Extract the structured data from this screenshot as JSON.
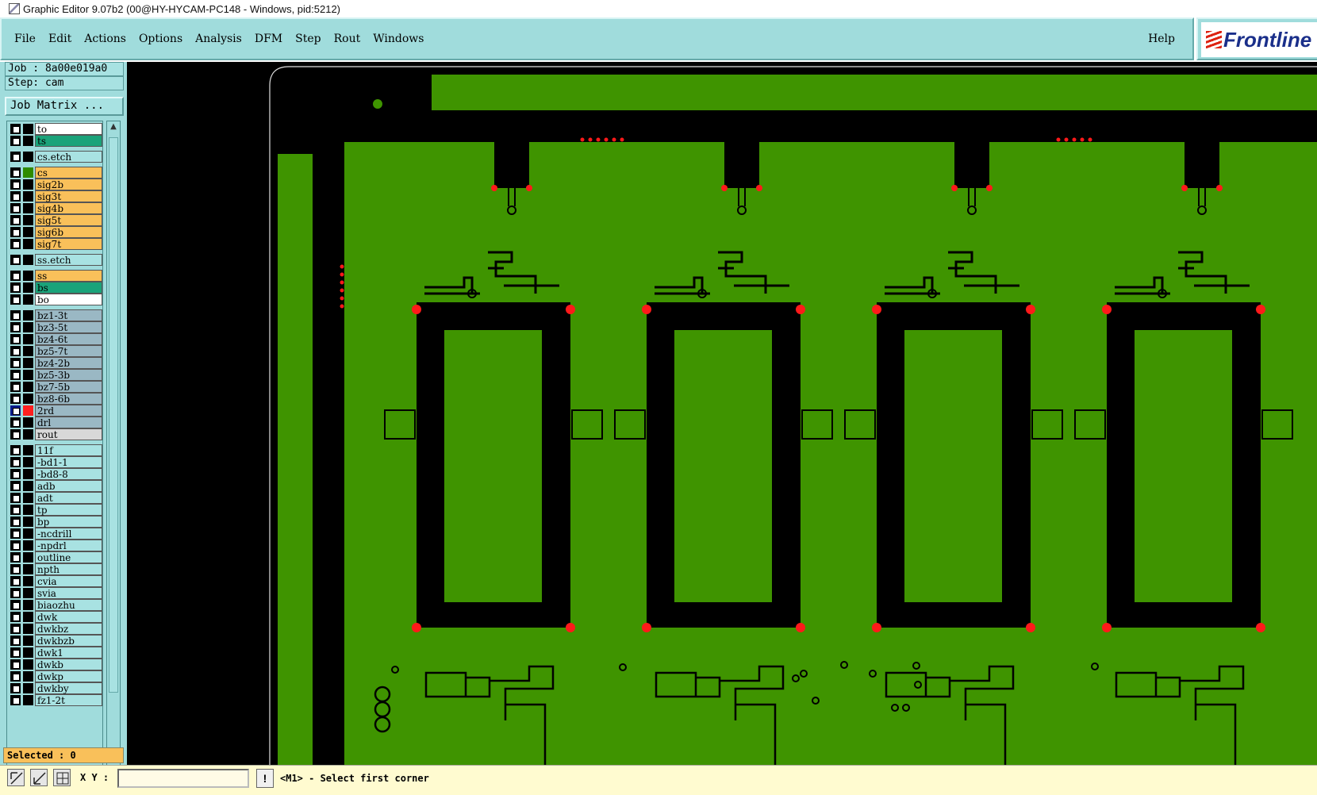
{
  "window": {
    "title": "Graphic Editor 9.07b2 (00@HY-HYCAM-PC148 - Windows, pid:5212)"
  },
  "menubar": {
    "items": [
      "File",
      "Edit",
      "Actions",
      "Options",
      "Analysis",
      "DFM",
      "Step",
      "Rout",
      "Windows"
    ],
    "help": "Help",
    "logo_text": "Frontline"
  },
  "job": {
    "job_label": "Job : 8a00e019a0",
    "step_label": "Step: cam",
    "matrix_button": "Job Matrix ..."
  },
  "layers": [
    {
      "name": "to",
      "color": "#ffffff",
      "swatch": "#000000",
      "group": 0
    },
    {
      "name": "ts",
      "color": "#1aa37a",
      "swatch": "#000000",
      "group": 0
    },
    {
      "name": "cs.etch",
      "color": "#a8e2e2",
      "swatch": "#000000",
      "group": 1
    },
    {
      "name": "cs",
      "color": "#f9c05a",
      "swatch": "#2e8b00",
      "group": 2
    },
    {
      "name": "sig2b",
      "color": "#f9c05a",
      "swatch": "#000000",
      "group": 2
    },
    {
      "name": "sig3t",
      "color": "#f9c05a",
      "swatch": "#000000",
      "group": 2
    },
    {
      "name": "sig4b",
      "color": "#f9c05a",
      "swatch": "#000000",
      "group": 2
    },
    {
      "name": "sig5t",
      "color": "#f9c05a",
      "swatch": "#000000",
      "group": 2
    },
    {
      "name": "sig6b",
      "color": "#f9c05a",
      "swatch": "#000000",
      "group": 2
    },
    {
      "name": "sig7t",
      "color": "#f9c05a",
      "swatch": "#000000",
      "group": 2
    },
    {
      "name": "ss.etch",
      "color": "#a8e2e2",
      "swatch": "#000000",
      "group": 3
    },
    {
      "name": "ss",
      "color": "#f9c05a",
      "swatch": "#000000",
      "group": 4
    },
    {
      "name": "bs",
      "color": "#1aa37a",
      "swatch": "#000000",
      "group": 4
    },
    {
      "name": "bo",
      "color": "#ffffff",
      "swatch": "#000000",
      "group": 4
    },
    {
      "name": "bz1-3t",
      "color": "#9ab8c4",
      "swatch": "#000000",
      "group": 5
    },
    {
      "name": "bz3-5t",
      "color": "#9ab8c4",
      "swatch": "#000000",
      "group": 5
    },
    {
      "name": "bz4-6t",
      "color": "#9ab8c4",
      "swatch": "#000000",
      "group": 5
    },
    {
      "name": "bz5-7t",
      "color": "#9ab8c4",
      "swatch": "#000000",
      "group": 5
    },
    {
      "name": "bz4-2b",
      "color": "#9ab8c4",
      "swatch": "#000000",
      "group": 5
    },
    {
      "name": "bz5-3b",
      "color": "#9ab8c4",
      "swatch": "#000000",
      "group": 5
    },
    {
      "name": "bz7-5b",
      "color": "#9ab8c4",
      "swatch": "#000000",
      "group": 5
    },
    {
      "name": "bz8-6b",
      "color": "#9ab8c4",
      "swatch": "#000000",
      "group": 5
    },
    {
      "name": "2rd",
      "color": "#9ab8c4",
      "swatch": "#ff2020",
      "group": 5,
      "active": true
    },
    {
      "name": "drl",
      "color": "#9ab8c4",
      "swatch": "#000000",
      "group": 5
    },
    {
      "name": "rout",
      "color": "#d8d8d8",
      "swatch": "#000000",
      "group": 5
    },
    {
      "name": "11f",
      "color": "#a8e2e2",
      "swatch": "#000000",
      "group": 6
    },
    {
      "name": "-bd1-1",
      "color": "#a8e2e2",
      "swatch": "#000000",
      "group": 6
    },
    {
      "name": "-bd8-8",
      "color": "#a8e2e2",
      "swatch": "#000000",
      "group": 6
    },
    {
      "name": "adb",
      "color": "#a8e2e2",
      "swatch": "#000000",
      "group": 6
    },
    {
      "name": "adt",
      "color": "#a8e2e2",
      "swatch": "#000000",
      "group": 6
    },
    {
      "name": "tp",
      "color": "#a8e2e2",
      "swatch": "#000000",
      "group": 6
    },
    {
      "name": "bp",
      "color": "#a8e2e2",
      "swatch": "#000000",
      "group": 6
    },
    {
      "name": "-ncdrill",
      "color": "#a8e2e2",
      "swatch": "#000000",
      "group": 6
    },
    {
      "name": "-npdrl",
      "color": "#a8e2e2",
      "swatch": "#000000",
      "group": 6
    },
    {
      "name": "outline",
      "color": "#a8e2e2",
      "swatch": "#000000",
      "group": 6
    },
    {
      "name": "npth",
      "color": "#a8e2e2",
      "swatch": "#000000",
      "group": 6
    },
    {
      "name": "cvia",
      "color": "#a8e2e2",
      "swatch": "#000000",
      "group": 6
    },
    {
      "name": "svia",
      "color": "#a8e2e2",
      "swatch": "#000000",
      "group": 6
    },
    {
      "name": "biaozhu",
      "color": "#a8e2e2",
      "swatch": "#000000",
      "group": 6
    },
    {
      "name": "dwk",
      "color": "#a8e2e2",
      "swatch": "#000000",
      "group": 6
    },
    {
      "name": "dwkbz",
      "color": "#a8e2e2",
      "swatch": "#000000",
      "group": 6
    },
    {
      "name": "dwkbzb",
      "color": "#a8e2e2",
      "swatch": "#000000",
      "group": 6
    },
    {
      "name": "dwk1",
      "color": "#a8e2e2",
      "swatch": "#000000",
      "group": 6
    },
    {
      "name": "dwkb",
      "color": "#a8e2e2",
      "swatch": "#000000",
      "group": 6
    },
    {
      "name": "dwkp",
      "color": "#a8e2e2",
      "swatch": "#000000",
      "group": 6
    },
    {
      "name": "dwkby",
      "color": "#a8e2e2",
      "swatch": "#000000",
      "group": 6
    },
    {
      "name": "fz1-2t",
      "color": "#a8e2e2",
      "swatch": "#000000",
      "group": 6
    }
  ],
  "selection": {
    "selected_label": "Selected : 0"
  },
  "statusbar": {
    "xy_label": "X Y :",
    "xy_value": "",
    "warn_symbol": "!",
    "prompt": "<M1> - Select first corner"
  },
  "canvas": {
    "board_color": "#3f9400",
    "background_color": "#000000",
    "pad_color": "#ff1a1a"
  }
}
